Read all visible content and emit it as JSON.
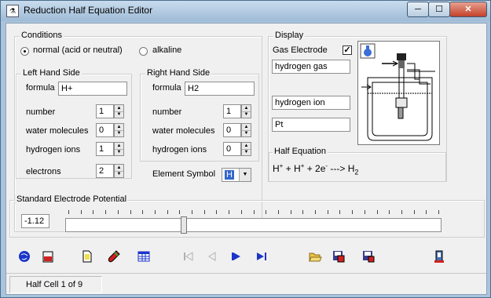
{
  "window": {
    "title": "Reduction Half Equation Editor",
    "controls": {
      "minimize": "─",
      "maximize": "☐",
      "close": "✕"
    }
  },
  "conditions": {
    "label": "Conditions",
    "options": [
      "normal (acid or neutral)",
      "alkaline"
    ],
    "selected": "normal (acid or neutral)"
  },
  "left_hand_side": {
    "label": "Left Hand Side",
    "formula_label": "formula",
    "formula": "H+",
    "fields": [
      {
        "label": "number",
        "value": "1"
      },
      {
        "label": "water molecules",
        "value": "0"
      },
      {
        "label": "hydrogen ions",
        "value": "1"
      },
      {
        "label": "electrons",
        "value": "2"
      }
    ]
  },
  "right_hand_side": {
    "label": "Right Hand Side",
    "formula_label": "formula",
    "formula": "H2",
    "fields": [
      {
        "label": "number",
        "value": "1"
      },
      {
        "label": "water molecules",
        "value": "0"
      },
      {
        "label": "hydrogen ions",
        "value": "0"
      }
    ]
  },
  "element_symbol": {
    "label": "Element Symbol",
    "value": "H"
  },
  "display": {
    "label": "Display",
    "gas_electrode_label": "Gas Electrode",
    "gas_electrode_checked": true,
    "check_mark": "✓",
    "gas_field": "hydrogen gas",
    "ion_field": "hydrogen ion",
    "metal_field": "Pt"
  },
  "half_equation": {
    "label": "Half Equation",
    "parts": {
      "h1": "H",
      "sup1": "+",
      "plus1": " + H",
      "sup2": "+",
      "plus2": " + 2e",
      "sup3": "-",
      "arrow": " ---> H",
      "sub": "2"
    }
  },
  "standard_electrode_potential": {
    "label": "Standard Electrode Potential",
    "value": "-1.12",
    "slider_fraction": 0.315
  },
  "toolbar": {
    "items": [
      "world-icon",
      "beaker-icon",
      "new-document-icon",
      "test-tube-icon",
      "table-icon",
      "first-icon",
      "previous-icon",
      "next-icon",
      "last-icon",
      "open-folder-icon",
      "save-icon",
      "save-as-icon",
      "exit-icon"
    ]
  },
  "status": {
    "text": "Half Cell 1 of 9"
  },
  "colors": {
    "accent": "#3366cc",
    "icon_blue": "#1a35c8",
    "icon_red": "#d02020"
  }
}
